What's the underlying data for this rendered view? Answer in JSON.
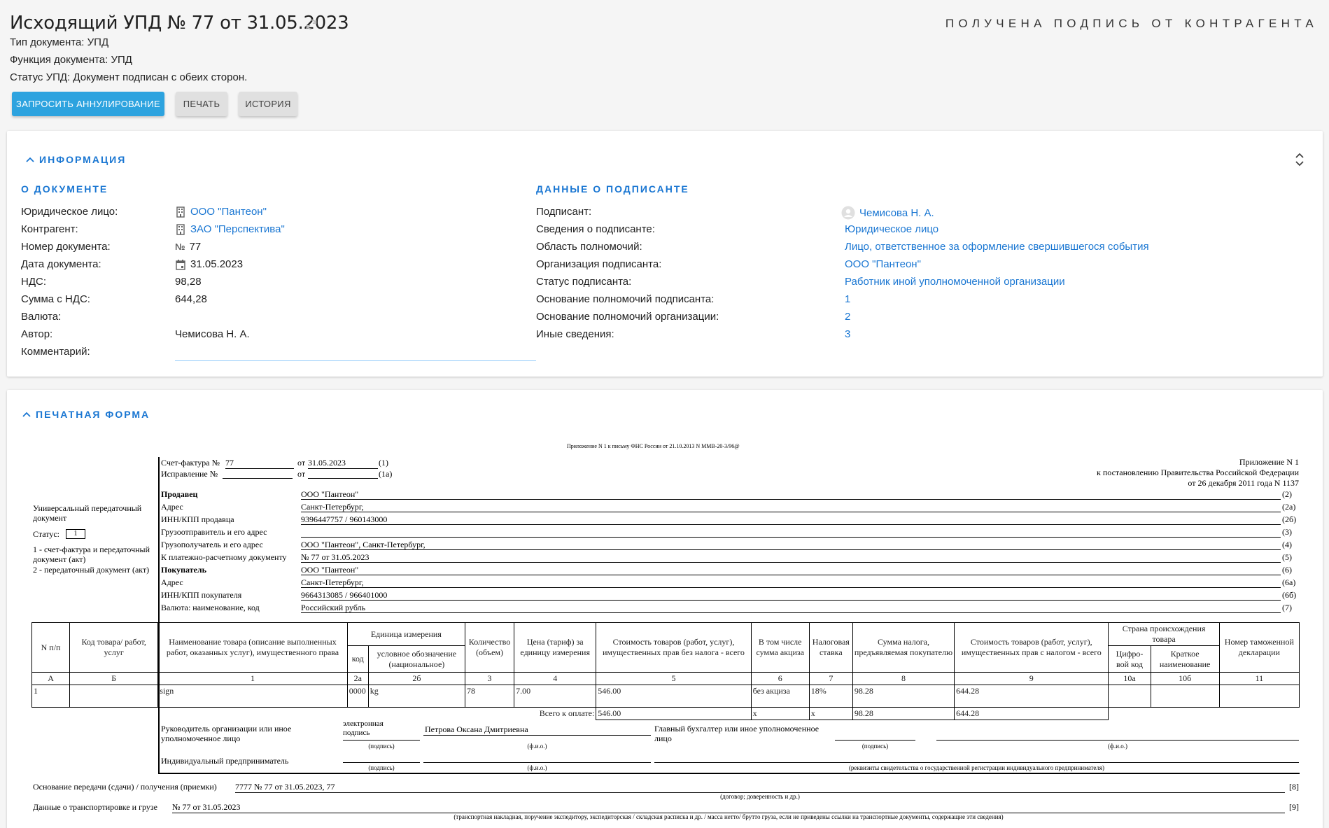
{
  "header": {
    "title": "Исходящий УПД № 77 от 31.05.2023",
    "status_right": "ПОЛУЧЕНА ПОДПИСЬ ОТ КОНТРАГЕНТА",
    "doc_type": "Тип документа: УПД",
    "doc_function": "Функция документа: УПД",
    "upd_status": "Статус УПД: Документ подписан с обеих сторон.",
    "btn_cancel": "ЗАПРОСИТЬ АННУЛИРОВАНИЕ",
    "btn_print": "ПЕЧАТЬ",
    "btn_history": "ИСТОРИЯ"
  },
  "info": {
    "title": "ИНФОРМАЦИЯ",
    "doc_section": "О ДОКУМЕНТЕ",
    "signer_section": "ДАННЫЕ О ПОДПИСАНТЕ",
    "doc_rows": [
      {
        "label": "Юридическое лицо:",
        "value": "ООО \"Пантеон\""
      },
      {
        "label": "Контрагент:",
        "value": "ЗАО \"Перспектива\""
      },
      {
        "label": "Номер документа:",
        "value": "77"
      },
      {
        "label": "Дата документа:",
        "value": "31.05.2023"
      },
      {
        "label": "НДС:",
        "value": "98,28"
      },
      {
        "label": "Сумма с НДС:",
        "value": "644,28"
      },
      {
        "label": "Валюта:",
        "value": ""
      },
      {
        "label": "Автор:",
        "value": "Чемисова Н. А."
      },
      {
        "label": "Комментарий:",
        "value": ""
      }
    ],
    "signer_rows": [
      {
        "label": "Подписант:",
        "value": "Чемисова Н. А."
      },
      {
        "label": "Сведения о подписанте:",
        "value": "Юридическое лицо"
      },
      {
        "label": "Область полномочий:",
        "value": "Лицо, ответственное за оформление свершившегося события"
      },
      {
        "label": "Организация подписанта:",
        "value": "ООО \"Пантеон\""
      },
      {
        "label": "Статус подписанта:",
        "value": "Работник иной уполномоченной организации"
      },
      {
        "label": "Основание полномочий подписанта:",
        "value": "1"
      },
      {
        "label": "Основание полномочий организации:",
        "value": "2"
      },
      {
        "label": "Иные сведения:",
        "value": "3"
      }
    ]
  },
  "print_form": {
    "title": "ПЕЧАТНАЯ ФОРМА",
    "letter": "Приложение N 1 к письму ФНС России от 21.10.2013 N ММВ-20-3/96@",
    "appendix1": "Приложение N 1",
    "appendix2": "к постановлению Правительства Российской Федерации",
    "appendix3": "от 26 декабря 2011 года N 1137",
    "invoice_label": "Счет-фактура №",
    "invoice_no": "77",
    "invoice_from": "от",
    "invoice_date": "31.05.2023",
    "correction_label": "Исправление №",
    "correction_from": "от",
    "upd_label": "Универсальный передаточный документ",
    "status_label": "Статус:",
    "status_value": "1",
    "status_note1": "1 - счет-фактура и передаточный документ (акт)",
    "status_note2": "2 - передаточный документ (акт)",
    "fields": [
      {
        "label": "Продавец",
        "value": "ООО \"Пантеон\"",
        "code": "(2)",
        "bold": true
      },
      {
        "label": "Адрес",
        "value": "Санкт-Петербург,",
        "code": "(2а)"
      },
      {
        "label": "ИНН/КПП продавца",
        "value": "9396447757 / 960143000",
        "code": "(2б)"
      },
      {
        "label": "Грузоотправитель и его адрес",
        "value": "",
        "code": "(3)"
      },
      {
        "label": "Грузополучатель и его адрес",
        "value": "ООО \"Пантеон\", Санкт-Петербург,",
        "code": "(4)"
      },
      {
        "label": "К платежно-расчетному документу",
        "value": "№ 77 от 31.05.2023",
        "code": "(5)"
      },
      {
        "label": "Покупатель",
        "value": "ООО \"Пантеон\"",
        "code": "(6)",
        "bold": true
      },
      {
        "label": "Адрес",
        "value": "Санкт-Петербург,",
        "code": "(6а)"
      },
      {
        "label": "ИНН/КПП покупателя",
        "value": "9664313085 / 966401000",
        "code": "(6б)"
      },
      {
        "label": "Валюта: наименование, код",
        "value": "Российский рубль",
        "code": "(7)"
      }
    ],
    "table": {
      "h_np": "N п/п",
      "h_code": "Код товара/ работ, услуг",
      "h_name": "Наименование товара (описание выполненных работ, оказанных услуг), имущественного права",
      "h_unit": "Единица измерения",
      "h_unit_code": "код",
      "h_unit_name": "условное обозначение (национальное)",
      "h_qty": "Количество (объем)",
      "h_price": "Цена (тариф) за единицу измерения",
      "h_cost": "Стоимость товаров (работ, услуг), имущественных прав без налога - всего",
      "h_excise": "В том числе сумма акциза",
      "h_rate": "Налоговая ставка",
      "h_tax": "Сумма налога, предъявляемая покупателю",
      "h_total": "Стоимость товаров (работ, услуг), имущественных прав с налогом - всего",
      "h_country": "Страна происхождения товара",
      "h_country_code": "Цифро-вой код",
      "h_country_name": "Краткое наименование",
      "h_customs": "Номер таможенной декларации",
      "nums": [
        "А",
        "Б",
        "1",
        "2а",
        "2б",
        "3",
        "4",
        "5",
        "6",
        "7",
        "8",
        "9",
        "10а",
        "10б",
        "11"
      ],
      "rows": [
        {
          "np": "1",
          "code": "",
          "name": "sign",
          "unit_code": "0000",
          "unit": "kg",
          "qty": "78",
          "price": "7.00",
          "cost": "546.00",
          "excise": "без акциза",
          "rate": "18%",
          "tax": "98.28",
          "total": "644.28",
          "cc": "",
          "cn": "",
          "customs": ""
        }
      ],
      "total_label": "Всего к оплате:",
      "total_cost": "546.00",
      "total_excise": "х",
      "total_rate": "х",
      "total_tax": "98.28",
      "total_total": "644.28"
    },
    "sign": {
      "head": "Руководитель организации или иное уполномоченное лицо",
      "e_sign": "электронная подпись",
      "head_name": "Петрова Оксана Дмитриевна",
      "chief": "Главный бухгалтер или иное уполномоченное лицо",
      "entrepreneur": "Индивидуальный предприниматель",
      "sub_sign": "(подпись)",
      "sub_fio": "(ф.и.о.)",
      "sub_req": "(реквизиты свидетельства о государственной регистрации индивидуального предпринимателя)"
    },
    "basis_label": "Основание передачи (сдачи) / получения (приемки)",
    "basis_value": "7777 № 77 от 31.05.2023, 77",
    "basis_code": "[8]",
    "basis_sub": "(договор; доверенность и др.)",
    "transport_label": "Данные о транспортировке и грузе",
    "transport_value": "№ 77 от 31.05.2023",
    "transport_code": "[9]",
    "transport_sub": "(транспортная накладная, поручение экспедитору, экспедиторская / складская расписка и др. / масса нетто/ брутто груза, если не приведены ссылки на транспортные документы, содержащие эти сведения)"
  }
}
